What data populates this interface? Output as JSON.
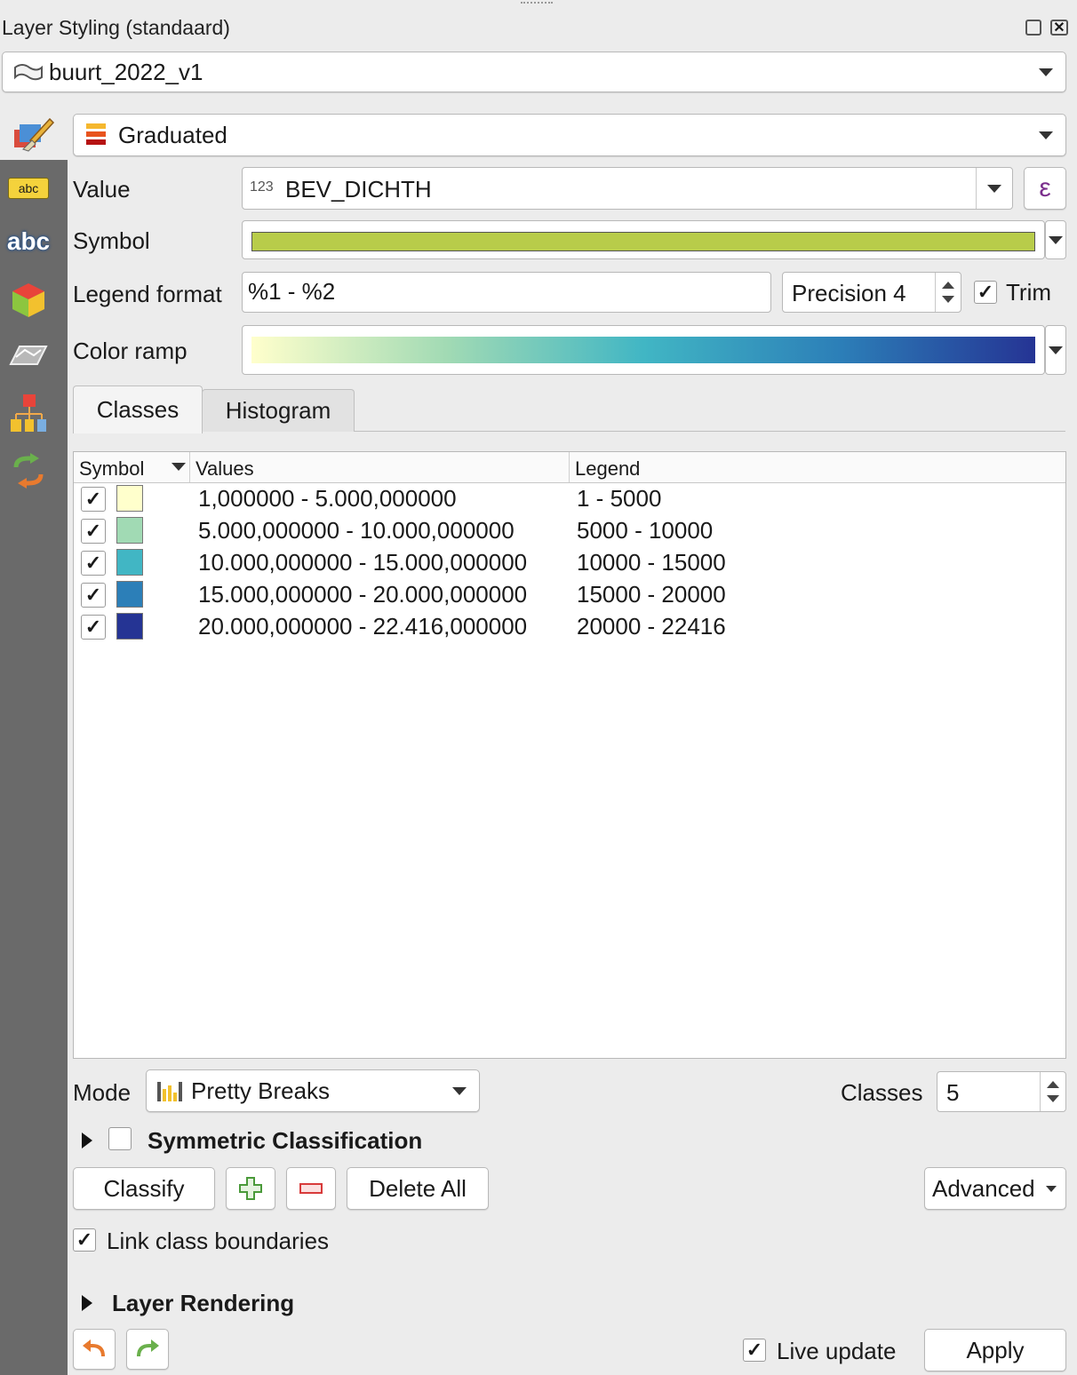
{
  "panel": {
    "title": "Layer Styling (standaard)"
  },
  "layer_select": {
    "value": "buurt_2022_v1"
  },
  "renderer_select": {
    "value": "Graduated"
  },
  "form": {
    "value_label": "Value",
    "value_type": "123",
    "value_field": "BEV_DICHTH",
    "expression_symbol": "ε",
    "symbol_label": "Symbol",
    "symbol_color": "#b8cc4a",
    "legend_format_label": "Legend format",
    "legend_format_value": "%1 - %2",
    "precision_value": "Precision 4",
    "trim_label": "Trim",
    "trim_check": "✓",
    "color_ramp_label": "Color ramp",
    "color_ramp_colors": [
      "#ffffcc",
      "#a1dab4",
      "#41b6c4",
      "#2c7fb8",
      "#253494"
    ]
  },
  "tabs": {
    "classes": "Classes",
    "histogram": "Histogram"
  },
  "table": {
    "col_symbol": "Symbol",
    "col_values": "Values",
    "col_legend": "Legend",
    "rows": [
      {
        "check": "✓",
        "color": "#ffffcc",
        "values": "1,000000 - 5.000,000000",
        "legend": "1 - 5000"
      },
      {
        "check": "✓",
        "color": "#a1dab4",
        "values": "5.000,000000 - 10.000,000000",
        "legend": "5000 - 10000"
      },
      {
        "check": "✓",
        "color": "#41b6c4",
        "values": "10.000,000000 - 15.000,000000",
        "legend": "10000 - 15000"
      },
      {
        "check": "✓",
        "color": "#2c7fb8",
        "values": "15.000,000000 - 20.000,000000",
        "legend": "15000 - 20000"
      },
      {
        "check": "✓",
        "color": "#253494",
        "values": "20.000,000000 - 22.416,000000",
        "legend": "20000 - 22416"
      }
    ]
  },
  "mode": {
    "label": "Mode",
    "value": "Pretty Breaks"
  },
  "classes_count": {
    "label": "Classes",
    "value": "5"
  },
  "symmetric": {
    "label": "Symmetric Classification"
  },
  "buttons": {
    "classify": "Classify",
    "delete_all": "Delete All",
    "advanced": "Advanced",
    "apply": "Apply"
  },
  "link_boundaries": {
    "label": "Link class boundaries",
    "check": "✓"
  },
  "layer_rendering": {
    "label": "Layer Rendering"
  },
  "live_update": {
    "label": "Live update",
    "check": "✓"
  }
}
